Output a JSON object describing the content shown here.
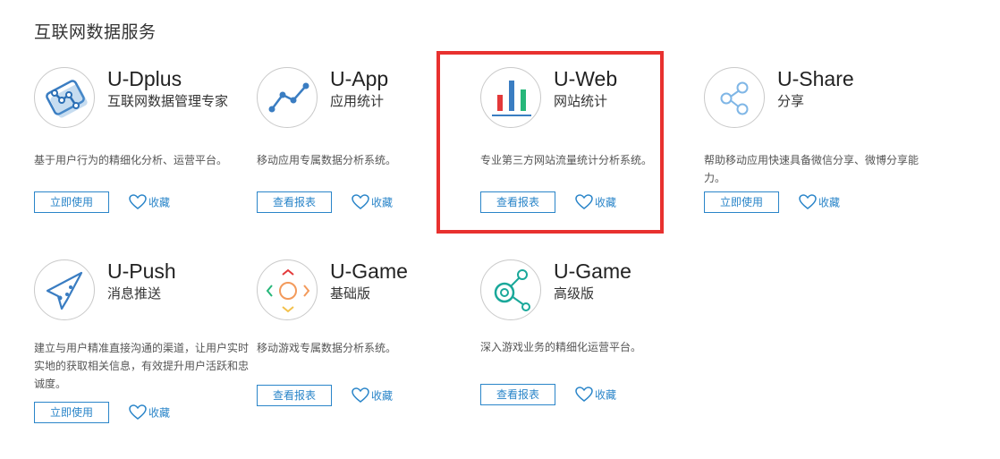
{
  "section": {
    "title": "互联网数据服务"
  },
  "colors": {
    "accent": "#2a85c9",
    "highlight": "#e8312f",
    "icon_blue": "#3a7dc2",
    "icon_red": "#e3393a",
    "icon_green": "#27b77a"
  },
  "cards": [
    {
      "name": "U-Dplus",
      "subtitle": "互联网数据管理专家",
      "desc": "基于用户行为的精细化分析、运营平台。",
      "button": "立即使用",
      "fav": "收藏",
      "icon": "dplus-logo-icon"
    },
    {
      "name": "U-App",
      "subtitle": "应用统计",
      "desc": "移动应用专属数据分析系统。",
      "button": "查看报表",
      "fav": "收藏",
      "icon": "line-chart-icon"
    },
    {
      "name": "U-Web",
      "subtitle": "网站统计",
      "desc": "专业第三方网站流量统计分析系统。",
      "button": "查看报表",
      "fav": "收藏",
      "icon": "bar-chart-icon",
      "highlighted": true
    },
    {
      "name": "U-Share",
      "subtitle": "分享",
      "desc": "帮助移动应用快速具备微信分享、微博分享能力。",
      "button": "立即使用",
      "fav": "收藏",
      "icon": "share-icon"
    },
    {
      "name": "U-Push",
      "subtitle": "消息推送",
      "desc": "建立与用户精准直接沟通的渠道，让用户实时实地的获取相关信息，有效提升用户活跃和忠诚度。",
      "button": "立即使用",
      "fav": "收藏",
      "icon": "paper-plane-icon"
    },
    {
      "name": "U-Game",
      "subtitle": "基础版",
      "desc": "移动游戏专属数据分析系统。",
      "button": "查看报表",
      "fav": "收藏",
      "icon": "gamepad-icon"
    },
    {
      "name": "U-Game",
      "subtitle": "高级版",
      "desc": "深入游戏业务的精细化运营平台。",
      "button": "查看报表",
      "fav": "收藏",
      "icon": "game-advanced-icon"
    }
  ]
}
